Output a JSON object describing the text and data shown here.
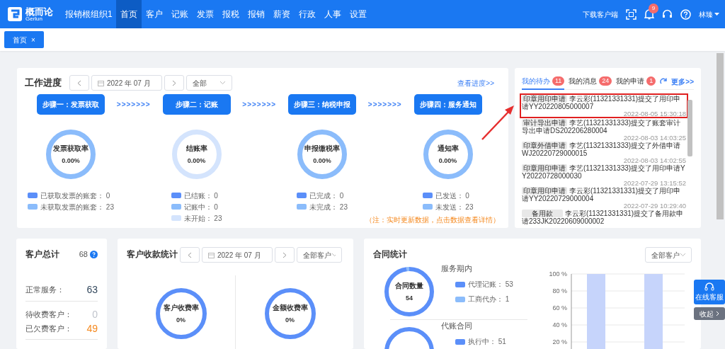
{
  "header": {
    "logo": {
      "name": "概而论",
      "sub": "Gerlun"
    },
    "org": "报销根组织1",
    "nav": [
      {
        "label": "首页",
        "selected": true
      },
      {
        "label": "客户",
        "selected": false
      },
      {
        "label": "记账",
        "selected": false
      },
      {
        "label": "发票",
        "selected": false
      },
      {
        "label": "报税",
        "selected": false
      },
      {
        "label": "报销",
        "selected": false
      },
      {
        "label": "薪资",
        "selected": false
      },
      {
        "label": "行政",
        "selected": false
      },
      {
        "label": "人事",
        "selected": false
      },
      {
        "label": "设置",
        "selected": false
      }
    ],
    "download": "下载客户端",
    "notifications": "9",
    "user": "林臻"
  },
  "tabs": [
    {
      "label": "首页",
      "close": "×",
      "selected": true
    }
  ],
  "work_progress": {
    "title": "工作进度",
    "date": "2022 年 07 月",
    "filter": "全部",
    "link": "查看进度>>",
    "arrow": ">>>>>>>",
    "steps": [
      {
        "label": "步骤一：发票获取",
        "ring_title": "发票获取率",
        "ring_value": "0.00%",
        "legend": [
          {
            "label": "已获取发票的账套：",
            "count": "0",
            "color": "#5b8ff9"
          },
          {
            "label": "未获取发票的账套：",
            "count": "23",
            "color": "#8bbcfb"
          }
        ]
      },
      {
        "label": "步骤二：记账",
        "ring_title": "结账率",
        "ring_value": "0.00%",
        "legend": [
          {
            "label": "已结账：",
            "count": "0",
            "color": "#5b8ff9"
          },
          {
            "label": "记账中：",
            "count": "0",
            "color": "#8bbcfb"
          },
          {
            "label": "未开始：",
            "count": "23",
            "color": "#d4e4fd"
          }
        ]
      },
      {
        "label": "步骤三：纳税申报",
        "ring_title": "申报缴税率",
        "ring_value": "0.00%",
        "legend": [
          {
            "label": "已完成：",
            "count": "0",
            "color": "#5b8ff9"
          },
          {
            "label": "未完成：",
            "count": "23",
            "color": "#8bbcfb"
          }
        ]
      },
      {
        "label": "步骤四：服务通知",
        "ring_title": "通知率",
        "ring_value": "0.00%",
        "legend": [
          {
            "label": "已发送：",
            "count": "0",
            "color": "#5b8ff9"
          },
          {
            "label": "未发送：",
            "count": "23",
            "color": "#8bbcfb"
          }
        ]
      }
    ],
    "note": "（注：实时更新数据，点击数据查看详情）"
  },
  "todo_panel": {
    "tabs": [
      {
        "label": "我的待办",
        "count": "11",
        "selected": true
      },
      {
        "label": "我的消息",
        "count": "24",
        "selected": false
      },
      {
        "label": "我的申请",
        "count": "1",
        "selected": false
      }
    ],
    "more": "更多>>",
    "items": [
      {
        "tag": "印章用印申请",
        "text": "李云彩(11321331331)提交了用印申请YY20220805000007",
        "time": "2022-08-05 15:30:18",
        "highlighted": true
      },
      {
        "tag": "审计导出申请",
        "text": "李艺(11321331333)提交了账套审计导出申请DS202206280004",
        "time": "2022-08-03 14:03:25",
        "highlighted": false
      },
      {
        "tag": "印章外借申请",
        "text": "李艺(11321331333)提交了外借申请WJ20220729000015",
        "time": "2022-08-03 14:02:55",
        "highlighted": false
      },
      {
        "tag": "印章用印申请",
        "text": "李艺(11321331333)提交了用印申请YY20220728000030",
        "time": "2022-07-29 13:15:52",
        "highlighted": false
      },
      {
        "tag": "印章用印申请",
        "text": "李云彩(11321331331)提交了用印申请YY20220729000004",
        "time": "2022-07-29 10:29:40",
        "highlighted": false
      },
      {
        "tag": "备用款",
        "text": "李云彩(11321331331)提交了备用款申请233JK20220609000002",
        "highlighted": false
      }
    ]
  },
  "customer_total": {
    "title": "客户总计",
    "count": "68",
    "stats": [
      {
        "label": "正常服务：",
        "value": "63",
        "color": "#34495e"
      },
      {
        "label": "待收费客户：",
        "value": "0",
        "color": "#c0c4cc"
      },
      {
        "label": "已欠费客户：",
        "value": "49",
        "color": "#f5891f"
      }
    ]
  },
  "collection": {
    "title": "客户收款统计",
    "date": "2022 年 07 月",
    "filter": "全部客户",
    "rings": [
      {
        "title": "客户收费率",
        "value": "0%"
      },
      {
        "title": "金额收费率",
        "value": "0%"
      }
    ]
  },
  "contracts": {
    "title": "合同统计",
    "filter": "全部客户",
    "groups": [
      {
        "title": "服务期内",
        "ring_title": "合同数量",
        "ring_value": "54",
        "legend": [
          {
            "label": "代理记账：",
            "count": "53",
            "color": "#5b8ff9"
          },
          {
            "label": "工商代办：",
            "count": "1",
            "color": "#8bbcfb"
          }
        ]
      },
      {
        "title": "代账合同",
        "legend": [
          {
            "label": "执行中：",
            "count": "51",
            "color": "#5b8ff9"
          }
        ]
      }
    ],
    "chart_data": {
      "type": "bar",
      "values": [
        100,
        100
      ],
      "ylim": [
        0,
        100
      ],
      "grid": true,
      "yticks": [
        {
          "value": 20,
          "label": "20 %"
        },
        {
          "value": 40,
          "label": "40 %"
        },
        {
          "value": 60,
          "label": "60 %"
        },
        {
          "value": 80,
          "label": "80 %"
        },
        {
          "value": 100,
          "label": "100 %"
        }
      ]
    }
  },
  "support": {
    "label": "在线客服",
    "collapse": "收起"
  }
}
